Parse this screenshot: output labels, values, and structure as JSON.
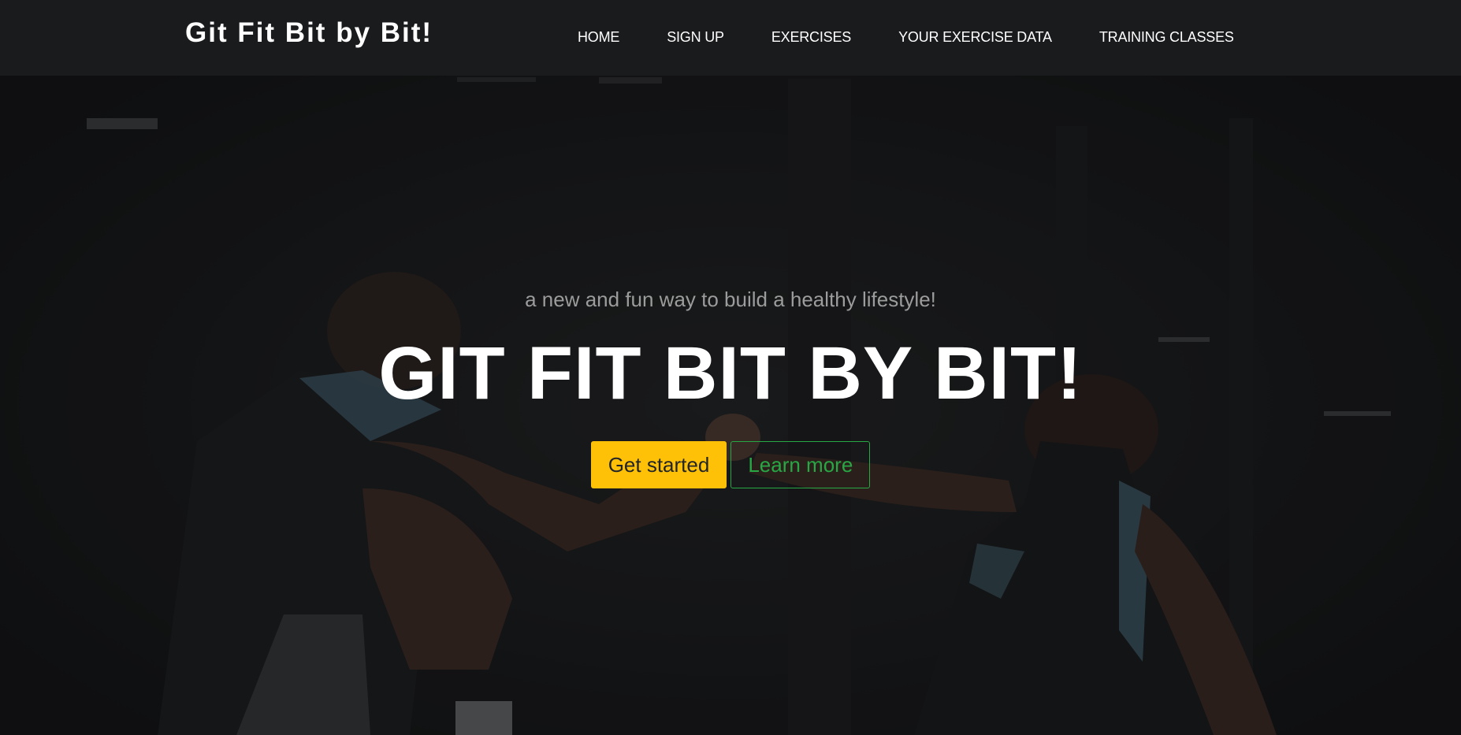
{
  "brand": {
    "name": "Git Fit Bit by Bit!"
  },
  "nav": {
    "items": [
      {
        "label": "HOME"
      },
      {
        "label": "SIGN UP"
      },
      {
        "label": "EXERCISES"
      },
      {
        "label": "YOUR EXERCISE DATA"
      },
      {
        "label": "TRAINING CLASSES"
      }
    ]
  },
  "hero": {
    "tagline": "a new and fun way to build a healthy lifestyle!",
    "title": "GIT FIT BIT BY BIT!",
    "primary_button": "Get started",
    "secondary_button": "Learn more",
    "background_image": "dark gym photo of a man and a woman arm wrestling while sitting on the floor"
  },
  "colors": {
    "background": "#17181a",
    "navbar": "#1a1b1d",
    "primary_button": "#ffc107",
    "secondary_button": "#28a745",
    "tagline": "#9c9c9c",
    "title": "#ffffff"
  }
}
